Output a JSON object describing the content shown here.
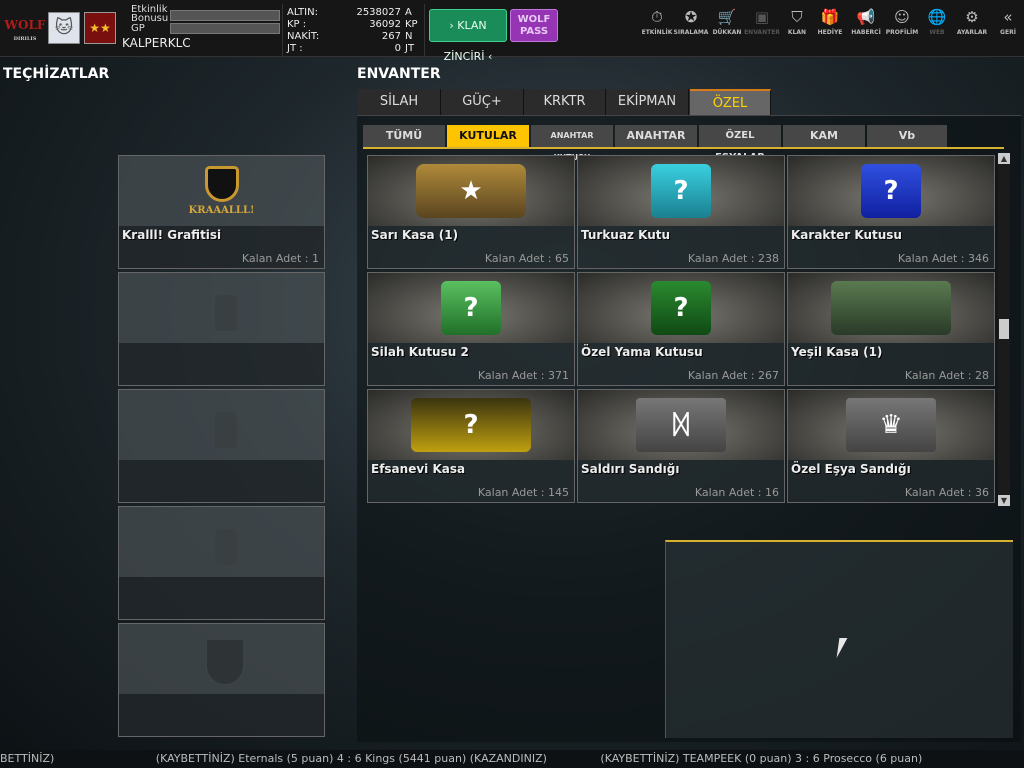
{
  "top": {
    "logo_text": "WOLF",
    "logo_sub": "DIRILIS",
    "event_bonus_label": "Etkinlik Bonusu",
    "gp_label": "GP",
    "username": "KALPERKLC",
    "stats": [
      {
        "label": "ALTIN:",
        "value": "2538027",
        "unit": "A"
      },
      {
        "label": "KP :",
        "value": "36092",
        "unit": "KP"
      },
      {
        "label": "NAKİT:",
        "value": "267",
        "unit": "N"
      },
      {
        "label": "JT :",
        "value": "0",
        "unit": "JT"
      }
    ],
    "klan_chain": "› KLAN ZİNCİRİ ‹",
    "wolf_pass": "WOLF PASS",
    "nav": [
      {
        "label": "ETKİNLİK",
        "icon": "⏱"
      },
      {
        "label": "SIRALAMA",
        "icon": "✪"
      },
      {
        "label": "DÜKKAN",
        "icon": "🛒"
      },
      {
        "label": "ENVANTER",
        "icon": "▣"
      },
      {
        "label": "KLAN",
        "icon": "⛉"
      },
      {
        "label": "HEDİYE",
        "icon": "🎁"
      },
      {
        "label": "HABERCİ",
        "icon": "📢"
      },
      {
        "label": "PROFİLİM",
        "icon": "☺"
      },
      {
        "label": "WEB",
        "icon": "🌐"
      },
      {
        "label": "AYARLAR",
        "icon": "⚙"
      },
      {
        "label": "GERİ",
        "icon": "«"
      }
    ]
  },
  "left": {
    "title": "TEÇHİZATLAR",
    "equipped": {
      "name": "Kralll! Grafitisi",
      "count": "Kalan Adet : 1",
      "logo_text": "KRAAALLL!"
    }
  },
  "inventory": {
    "title": "ENVANTER",
    "tabs": [
      "SİLAH",
      "GÜÇ+",
      "KRKTR",
      "EKİPMAN",
      "ÖZEL"
    ],
    "subtabs": [
      "TÜMÜ",
      "KUTULAR",
      "ANAHTAR KUTUSU",
      "ANAHTAR",
      "ÖZEL EŞYALAR",
      "KAM",
      "Vb"
    ],
    "items": [
      {
        "name": "Sarı Kasa (1)",
        "count": "Kalan Adet : 65"
      },
      {
        "name": "Turkuaz Kutu",
        "count": "Kalan Adet : 238"
      },
      {
        "name": "Karakter Kutusu",
        "count": "Kalan Adet : 346"
      },
      {
        "name": "Silah Kutusu 2",
        "count": "Kalan Adet : 371"
      },
      {
        "name": "Özel Yama Kutusu",
        "count": "Kalan Adet : 267"
      },
      {
        "name": "Yeşil Kasa (1)",
        "count": "Kalan Adet : 28"
      },
      {
        "name": "Efsanevi Kasa",
        "count": "Kalan Adet : 145"
      },
      {
        "name": "Saldırı Sandığı",
        "count": "Kalan Adet : 16"
      },
      {
        "name": "Özel Eşya Sandığı",
        "count": "Kalan Adet : 36"
      }
    ]
  },
  "ticker": [
    "BETTİNİZ)",
    "(KAYBETTİNİZ) Eternals (5 puan) 4 : 6 Kings (5441 puan) (KAZANDINIZ)",
    "(KAYBETTİNİZ) TEAMPEEK (0 puan) 3 : 6 Prosecco (6 puan)"
  ]
}
